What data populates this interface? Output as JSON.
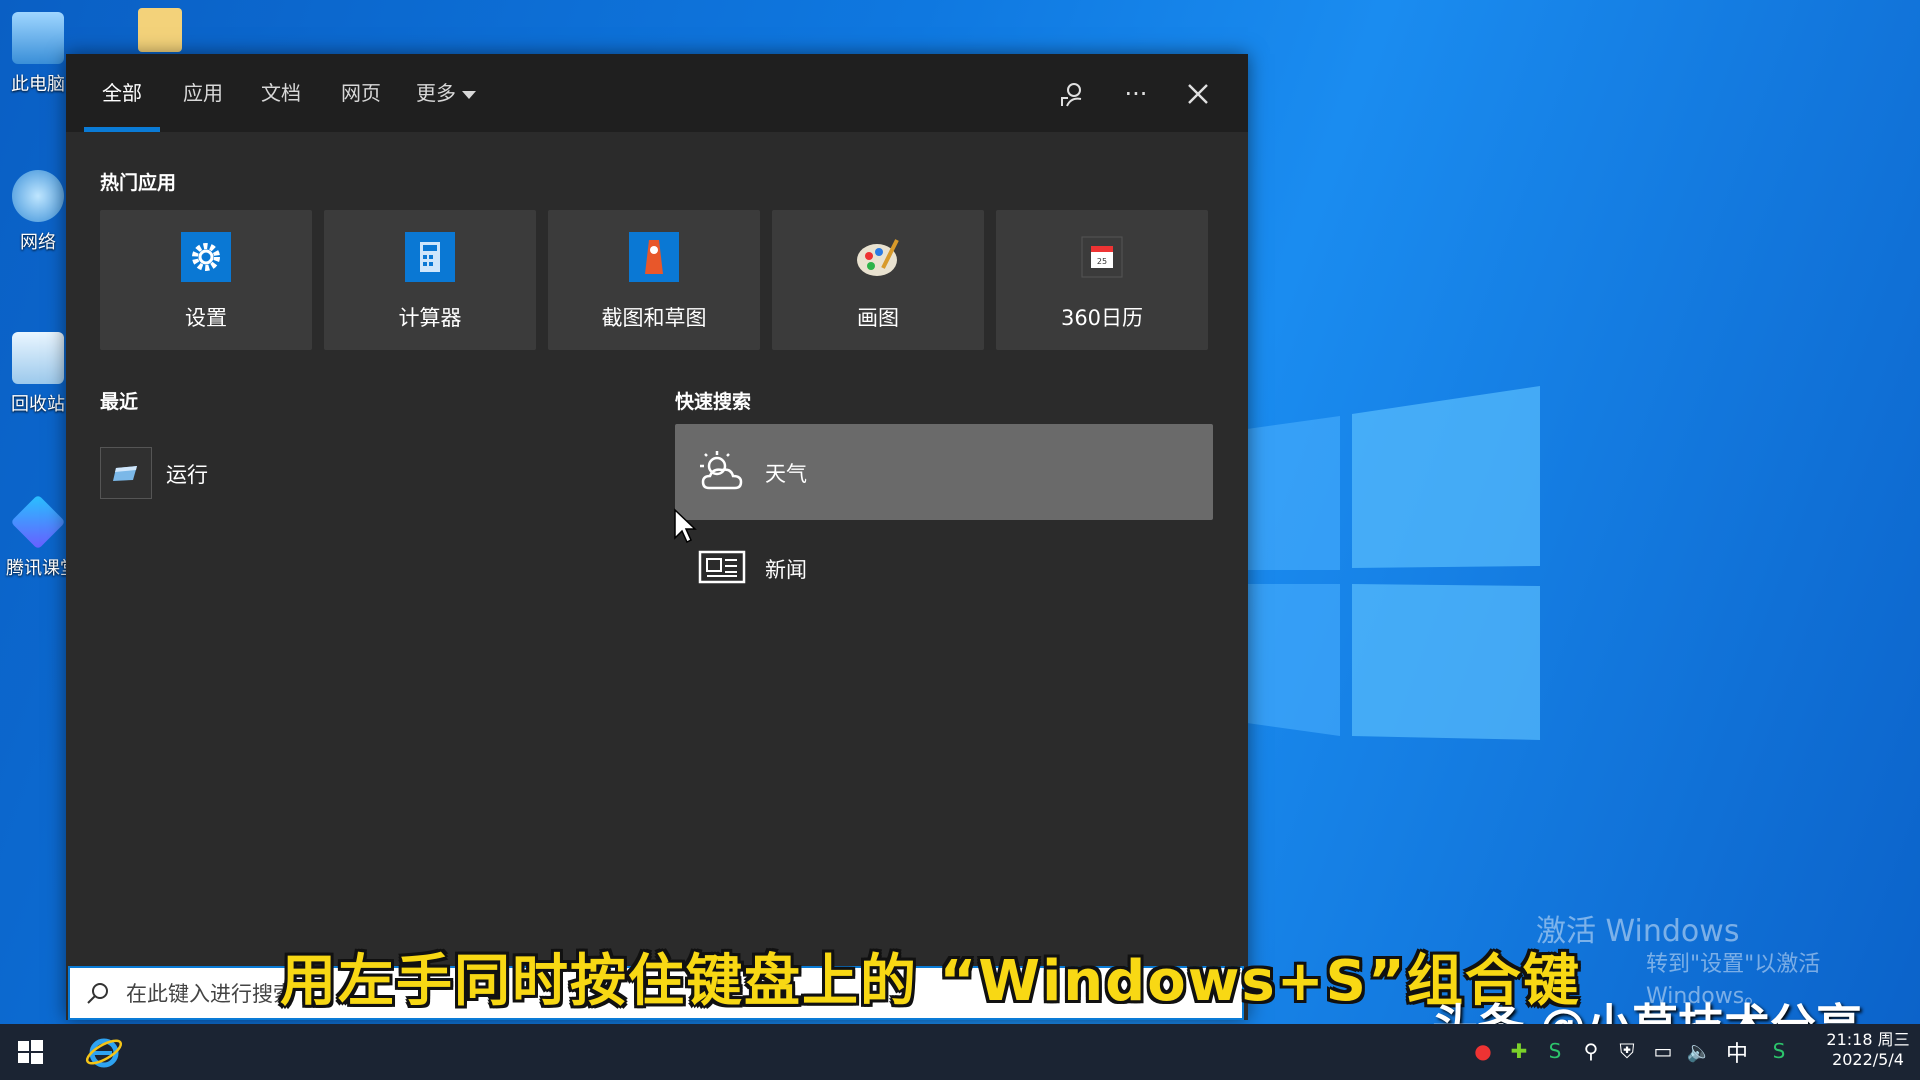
{
  "desktop": {
    "icons": [
      {
        "label": "此电脑",
        "icon": "computer-icon"
      },
      {
        "label": "网络",
        "icon": "network-icon"
      },
      {
        "label": "回收站",
        "icon": "recycle-bin-icon"
      },
      {
        "label": "腾讯课堂",
        "icon": "tencent-classroom-icon"
      }
    ],
    "activate_title": "激活 Windows",
    "activate_sub": "转到\"设置\"以激活 Windows。"
  },
  "search_panel": {
    "tabs": [
      {
        "label": "全部",
        "active": true
      },
      {
        "label": "应用"
      },
      {
        "label": "文档"
      },
      {
        "label": "网页"
      },
      {
        "label": "更多"
      }
    ],
    "top_actions": [
      "feedback-icon",
      "more-options-icon",
      "close-icon"
    ],
    "more_glyph": "···",
    "popular_title": "热门应用",
    "popular_apps": [
      {
        "label": "设置",
        "icon": "settings-gear-icon"
      },
      {
        "label": "计算器",
        "icon": "calculator-icon"
      },
      {
        "label": "截图和草图",
        "icon": "snip-sketch-icon"
      },
      {
        "label": "画图",
        "icon": "paint-palette-icon"
      },
      {
        "label": "360日历",
        "icon": "calendar-360-icon"
      }
    ],
    "recent_title": "最近",
    "recent_items": [
      {
        "label": "运行",
        "icon": "run-dialog-icon"
      }
    ],
    "quick_title": "快速搜索",
    "quick_items": [
      {
        "label": "天气",
        "icon": "weather-icon",
        "highlighted": true
      },
      {
        "label": "新闻",
        "icon": "news-icon"
      }
    ],
    "search_placeholder": "在此键入进行搜索"
  },
  "overlay": {
    "subtitle": "用左手同时按住键盘上的 “Windows+S”组合键",
    "brand": "头条 @小草技术分享"
  },
  "taskbar": {
    "ime": "中",
    "time": "21:18 周三",
    "date": "2022/5/4",
    "accent": "#0a7bd6"
  }
}
